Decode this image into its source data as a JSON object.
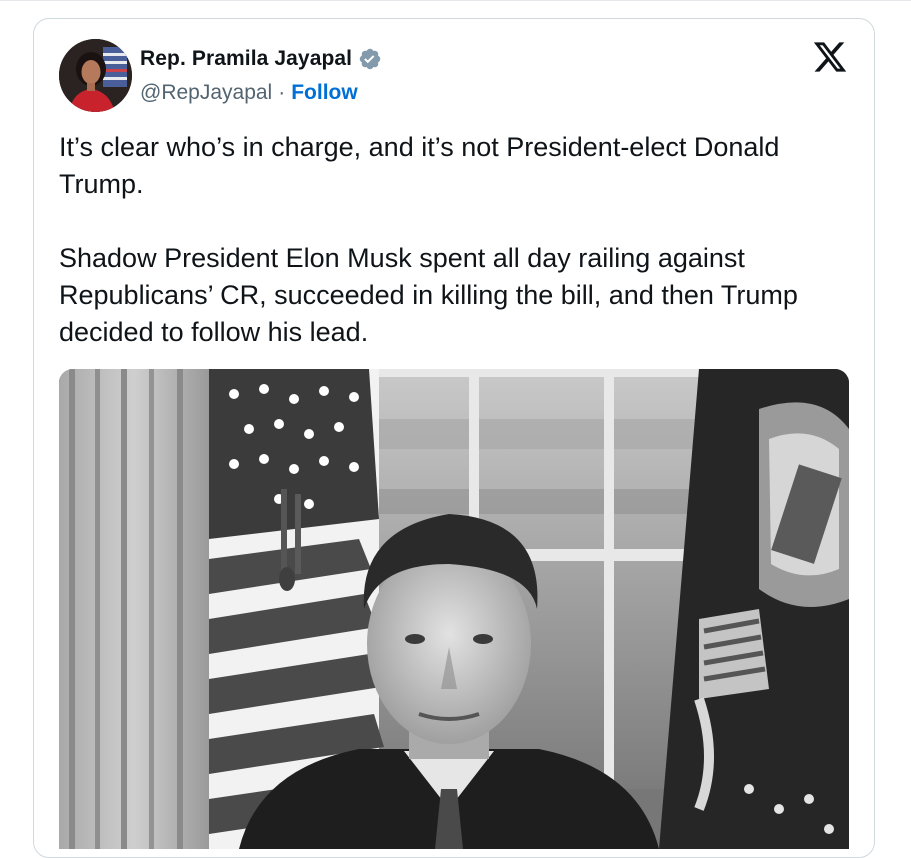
{
  "tweet": {
    "author": {
      "display_name": "Rep. Pramila Jayapal",
      "handle": "@RepJayapal",
      "separator": "·",
      "follow_label": "Follow",
      "verified": true,
      "verified_color": "#829aab"
    },
    "text": "It’s clear who’s in charge, and it’s not President-elect Donald Trump.\n\nShadow President Elon Musk spent all day railing against Republicans’ CR, succeeded in killing the bill, and then Trump decided to follow his lead.",
    "platform_icon": "x-logo-icon",
    "media": {
      "type": "photo",
      "style": "black-and-white",
      "scene_icons": [
        "american-flag",
        "presidential-flag",
        "window",
        "curtain",
        "portrait"
      ]
    }
  },
  "colors": {
    "text_primary": "#0f1419",
    "text_secondary": "#536471",
    "link_blue": "#006fd6",
    "card_border": "#cfd9de"
  }
}
